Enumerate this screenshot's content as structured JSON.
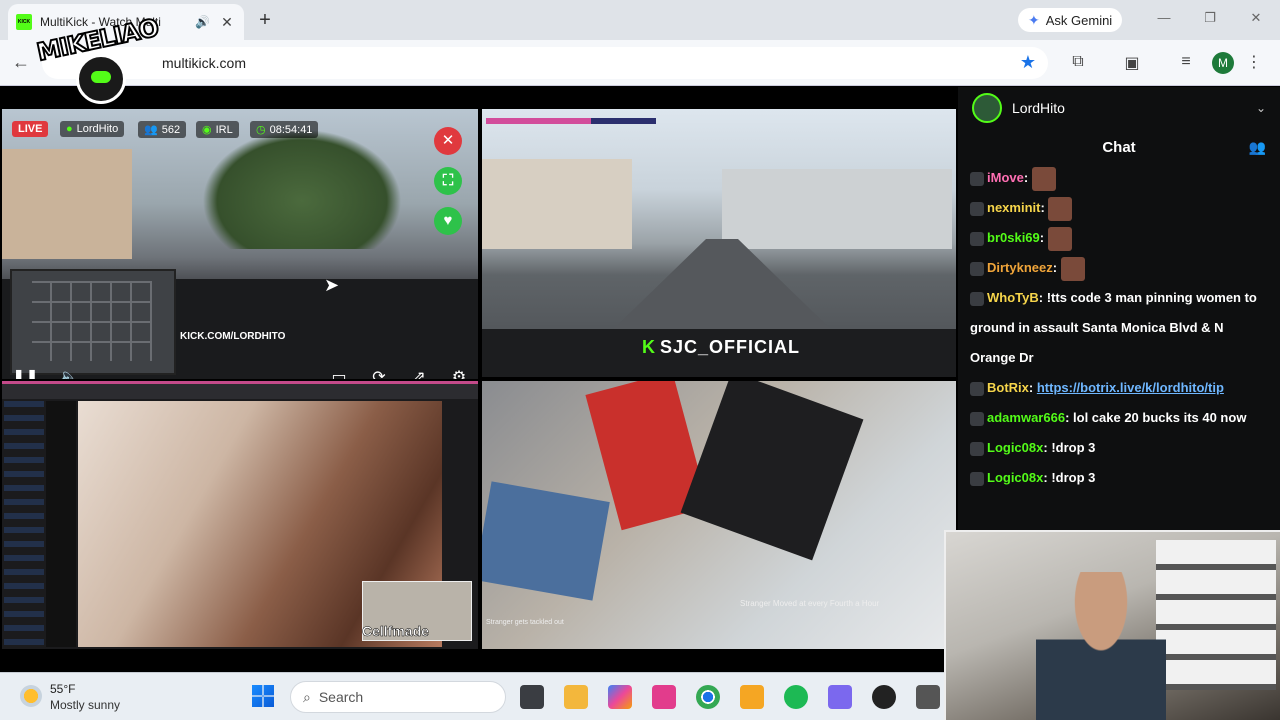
{
  "browser": {
    "tab_title": "MultiKick - Watch Multi",
    "tab_favicon": "KICK",
    "new_tab": "+",
    "ask_gemini": "Ask Gemini",
    "url": "multikick.com",
    "profile_initial": "M"
  },
  "overlay_logo": "MIKELIAO",
  "streams": {
    "tile1": {
      "live": "LIVE",
      "channel": "LordHito",
      "viewers": "562",
      "irl": "IRL",
      "uptime": "08:54:41",
      "overlay_text": "KICK.COM/LORDHITO"
    },
    "tile2": {
      "label": "SJC_OFFICIAL",
      "progress_fraction": 0.62
    },
    "tile3": {
      "credit": "Cellfmade"
    },
    "tile4": {
      "caption": "Stranger Moved at every Fourth a Hour",
      "caption2": "Stranger gets tackled out"
    }
  },
  "chat": {
    "channel": "LordHito",
    "title": "Chat",
    "messages": [
      {
        "user": "iMove",
        "text": "",
        "color": "#ff6fb3"
      },
      {
        "user": "nexminit",
        "text": "",
        "color": "#f6d54b"
      },
      {
        "user": "br0ski69",
        "text": "",
        "color": "#53fc18"
      },
      {
        "user": "Dirtykneez",
        "text": "",
        "color": "#f0a53a"
      },
      {
        "user": "WhoTyB",
        "text": "!tts code 3 man pinning women to ground in assault Santa Monica Blvd & N Orange Dr",
        "color": "#f6d54b"
      },
      {
        "user": "BotRix",
        "text": "https://botrix.live/k/lordhito/tip",
        "color": "#f6d54b"
      },
      {
        "user": "adamwar666",
        "text": "lol cake 20 bucks its 40 now",
        "color": "#53fc18"
      },
      {
        "user": "Logic08x",
        "text": "!drop 3",
        "color": "#53fc18"
      },
      {
        "user": "Logic08x",
        "text": "!drop 3",
        "color": "#53fc18"
      }
    ]
  },
  "taskbar": {
    "temperature": "55°F",
    "condition": "Mostly sunny",
    "search_placeholder": "Search"
  }
}
